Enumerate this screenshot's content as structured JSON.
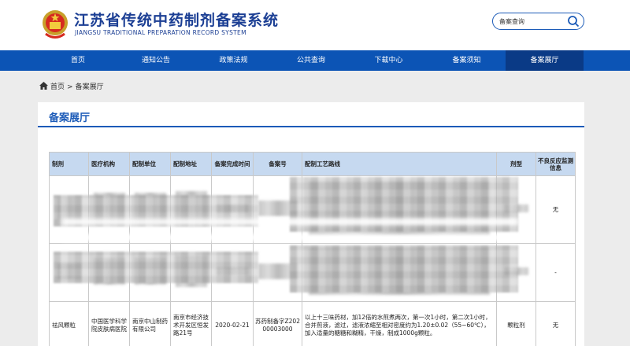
{
  "header": {
    "title": "江苏省传统中药制剂备案系统",
    "subtitle": "JIANGSU TRADITIONAL PREPARATION RECORD SYSTEM",
    "search_placeholder": "备案查询"
  },
  "nav": {
    "items": [
      {
        "label": "首页"
      },
      {
        "label": "通知公告"
      },
      {
        "label": "政策法规"
      },
      {
        "label": "公共查询"
      },
      {
        "label": "下载中心"
      },
      {
        "label": "备案须知"
      },
      {
        "label": "备案展厅"
      }
    ],
    "active_index": 6
  },
  "breadcrumb": {
    "home": "首页",
    "separator": ">",
    "current": "备案展厅"
  },
  "panel": {
    "title": "备案展厅"
  },
  "table": {
    "headers": [
      "制剂",
      "医疗机构",
      "配制单位",
      "配制地址",
      "备案完成时间",
      "备案号",
      "配制工艺路线",
      "剂型",
      "不良反应监测信息"
    ],
    "rows": [
      {
        "name": "",
        "institution": "",
        "unit": "",
        "address": "",
        "date": "",
        "record_no": "",
        "process": "",
        "form": "",
        "adverse": "无"
      },
      {
        "name": "",
        "institution": "",
        "unit": "",
        "address": "",
        "date": "",
        "record_no": "",
        "process": "",
        "form": "",
        "adverse": "-"
      },
      {
        "name": "祛风颗粒",
        "institution": "中国医学科学院皮肤病医院",
        "unit": "南京中山制药有限公司",
        "address": "南京市经济技术开发区恒发路21号",
        "date": "2020-02-21",
        "record_no": "苏药制备字Z20200003000",
        "process": "以上十三味药材，加12倍的水煎煮两次，第一次1小时，第二次1小时，合并煎液，滤过，滤液浓缩至相对密度约为1.20±0.02（55~60℃），加入适量的糖糖和糊精，干燥，制成1000g颗粒。",
        "form": "颗粒剂",
        "adverse": "无"
      }
    ]
  },
  "colors": {
    "brand_blue": "#0c54b5",
    "nav_active": "#0a3a86",
    "title_blue": "#1c3f94",
    "table_header_bg": "#c6d9f0"
  }
}
